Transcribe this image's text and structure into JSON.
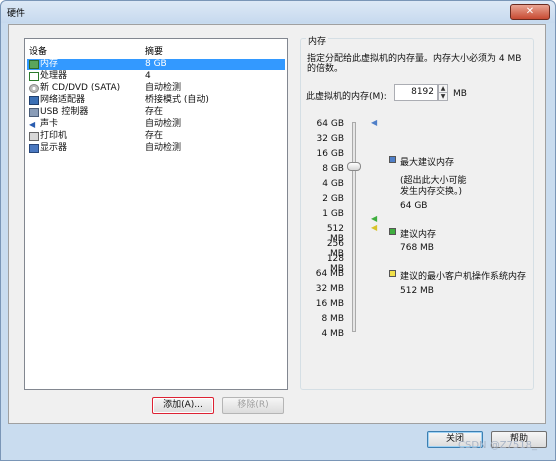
{
  "window": {
    "title": "硬件",
    "close_glyph": "✕"
  },
  "device_list": {
    "col_device": "设备",
    "col_summary": "摘要",
    "rows": [
      {
        "device": "内存",
        "summary": "8 GB",
        "icon": "memory-icon",
        "selected": true
      },
      {
        "device": "处理器",
        "summary": "4",
        "icon": "processor-icon"
      },
      {
        "device": "新 CD/DVD (SATA)",
        "summary": "自动检测",
        "icon": "cd-dvd-icon"
      },
      {
        "device": "网络适配器",
        "summary": "桥接模式 (自动)",
        "icon": "network-adapter-icon"
      },
      {
        "device": "USB 控制器",
        "summary": "存在",
        "icon": "usb-icon"
      },
      {
        "device": "声卡",
        "summary": "自动检测",
        "icon": "sound-card-icon"
      },
      {
        "device": "打印机",
        "summary": "存在",
        "icon": "printer-icon"
      },
      {
        "device": "显示器",
        "summary": "自动检测",
        "icon": "display-icon"
      }
    ]
  },
  "buttons": {
    "add": "添加(A)...",
    "remove": "移除(R)",
    "close": "关闭",
    "help": "帮助"
  },
  "memory": {
    "group_title": "内存",
    "description": "指定分配给此虚拟机的内存量。内存大小必须为 4 MB 的倍数。",
    "field_label": "此虚拟机的内存(M):",
    "value": "8192",
    "unit": "MB",
    "scale_ticks": [
      "64 GB",
      "32 GB",
      "16 GB",
      "8 GB",
      "4 GB",
      "2 GB",
      "1 GB",
      "512 MB",
      "256 MB",
      "128 MB",
      "64 MB",
      "32 MB",
      "16 MB",
      "8 MB",
      "4 MB"
    ],
    "legend": {
      "max_title": "最大建议内存",
      "max_note_1": "(超出此大小可能",
      "max_note_2": "发生内存交换。)",
      "max_value": "64 GB",
      "recommended_title": "建议内存",
      "recommended_value": "768 MB",
      "min_title": "建议的最小客户机操作系统内存",
      "min_value": "512 MB"
    },
    "colors": {
      "max": "#4f7fc8",
      "recommended": "#3fae3f",
      "min": "#f0e04a"
    }
  },
  "watermark": "CSDN @Z7518_"
}
